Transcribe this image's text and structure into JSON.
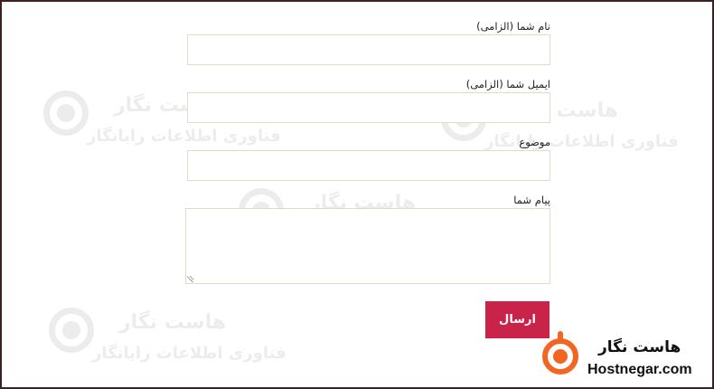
{
  "watermark": {
    "title": "هاست نگار",
    "subtitle": "فناوری اطلاعات رایانگار"
  },
  "form": {
    "name_label": "نام شما (الزامی)",
    "email_label": "ایمیل شما (الزامی)",
    "subject_label": "موضوع",
    "message_label": "پیام شما",
    "name_value": "",
    "email_value": "",
    "subject_value": "",
    "message_value": "",
    "submit_label": "ارسال"
  },
  "brand": {
    "name_fa": "هاست نگار",
    "name_en": "Hostnegar.com",
    "logo_icon": "hostnegar-logo-icon",
    "accent_color": "#f26522",
    "button_color": "#c9234a"
  }
}
